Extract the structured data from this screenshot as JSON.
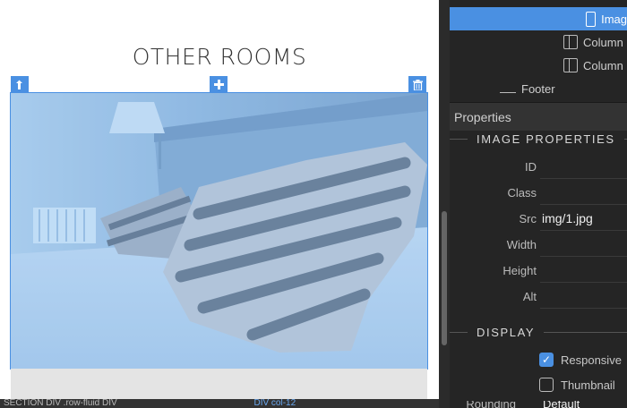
{
  "canvas": {
    "heading": "OTHER ROOMS",
    "image_alt": "bed pillows",
    "image_tint": "#4a90e2",
    "statusbar": {
      "left": "SECTION  DIV .row-fluid  DIV",
      "right": "DIV col-12 "
    }
  },
  "handles": {
    "top_left_icon": "move-up-icon",
    "top_center_icon": "plus-icon",
    "top_right_icon": "trash-icon",
    "bottom_center_icon": "plus-icon",
    "bottom_right_icon": "clone-icon"
  },
  "tree": {
    "items": [
      {
        "label": "Imag",
        "icon": "image-icon",
        "selected": true
      },
      {
        "label": "Column",
        "icon": "column-icon"
      },
      {
        "label": "Column",
        "icon": "column-icon"
      },
      {
        "label": "Footer",
        "icon": "footer-icon"
      }
    ]
  },
  "properties": {
    "header": "Properties",
    "image_section": "IMAGE PROPERTIES",
    "fields": [
      {
        "label": "ID",
        "value": ""
      },
      {
        "label": "Class",
        "value": ""
      },
      {
        "label": "Src",
        "value": "img/1.jpg"
      },
      {
        "label": "Width",
        "value": ""
      },
      {
        "label": "Height",
        "value": ""
      },
      {
        "label": "Alt",
        "value": ""
      }
    ],
    "display_section": "DISPLAY",
    "responsive_label": "Responsive",
    "responsive_checked": true,
    "thumbnail_label": "Thumbnail",
    "thumbnail_checked": false,
    "cut_label": "Rounding",
    "cut_value": "Default"
  },
  "colors": {
    "accent": "#4a90e2",
    "panel_bg": "#252525",
    "canvas_bg": "#ffffff"
  }
}
